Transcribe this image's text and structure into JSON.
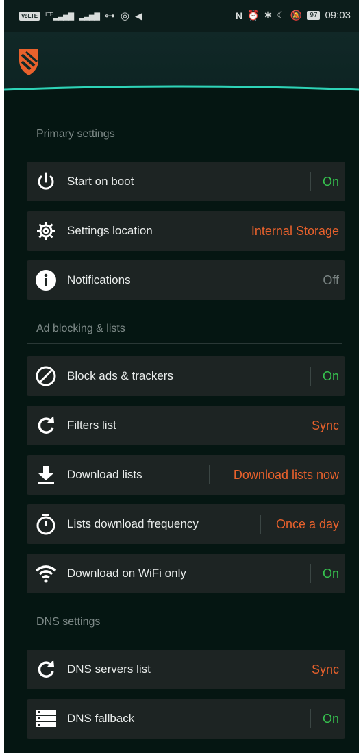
{
  "status_bar": {
    "left_badge": "VoLTE",
    "network": "LTE",
    "battery": "97",
    "time": "09:03"
  },
  "sections": [
    {
      "title": "Primary settings",
      "items": [
        {
          "label": "Start on boot",
          "value": "On",
          "icon": "power-icon"
        },
        {
          "label": "Settings location",
          "value": "Internal Storage",
          "icon": "gear-icon"
        },
        {
          "label": "Notifications",
          "value": "Off",
          "icon": "info-icon"
        }
      ]
    },
    {
      "title": "Ad blocking & lists",
      "items": [
        {
          "label": "Block ads & trackers",
          "value": "On",
          "icon": "block-icon"
        },
        {
          "label": "Filters list",
          "value": "Sync",
          "icon": "refresh-icon"
        },
        {
          "label": "Download lists",
          "value": "Download lists now",
          "icon": "download-icon"
        },
        {
          "label": "Lists download frequency",
          "value": "Once a day",
          "icon": "stopwatch-icon"
        },
        {
          "label": "Download on WiFi only",
          "value": "On",
          "icon": "wifi-icon"
        }
      ]
    },
    {
      "title": "DNS settings",
      "items": [
        {
          "label": "DNS servers list",
          "value": "Sync",
          "icon": "refresh-icon"
        },
        {
          "label": "DNS fallback",
          "value": "On",
          "icon": "server-icon"
        }
      ]
    }
  ],
  "colors": {
    "background": "#051612",
    "header": "#112827",
    "accent_line": "#2ed3b7",
    "on": "#36c54f",
    "off": "#7a8483",
    "action": "#e8612c"
  }
}
